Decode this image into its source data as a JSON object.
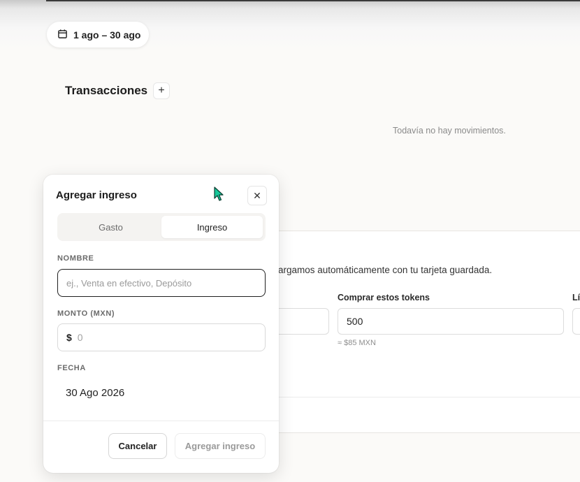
{
  "header": {
    "date_range": "1 ago – 30 ago",
    "date_range_icon": "calendar-icon"
  },
  "transactions": {
    "title": "Transacciones",
    "add_icon": "plus-icon",
    "empty_message": "Todavía no hay movimientos."
  },
  "background_card": {
    "description": "argamos automáticamente con tu tarjeta guardada.",
    "buy_tokens_label": "Comprar estos tokens",
    "buy_tokens_value": "500",
    "buy_tokens_hint": "≈ $85 MXN",
    "third_label": "Lí"
  },
  "modal": {
    "title": "Agregar ingreso",
    "close_icon": "close-icon",
    "tabs": [
      {
        "label": "Gasto",
        "active": false
      },
      {
        "label": "Ingreso",
        "active": true
      }
    ],
    "name_label": "NOMBRE",
    "name_placeholder": "ej., Venta en efectivo, Depósito",
    "amount_label": "MONTO (MXN)",
    "currency_symbol": "$",
    "amount_placeholder": "0",
    "date_label": "FECHA",
    "date_value": "30 Ago 2026",
    "cancel_label": "Cancelar",
    "submit_label": "Agregar ingreso"
  },
  "colors": {
    "cursor": "#17c79a",
    "focus_border": "#1f1f1f"
  }
}
